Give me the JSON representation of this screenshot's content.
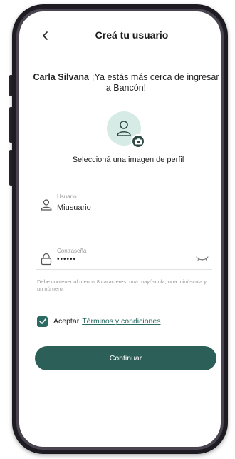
{
  "header": {
    "title": "Creá tu usuario"
  },
  "greeting": {
    "name": "Carla Silvana",
    "message": "¡Ya estás más cerca de ingresar a Bancón!"
  },
  "profile": {
    "label": "Seleccioná una imagen de perfil"
  },
  "username_field": {
    "label": "Usuario",
    "value": "Miusuario"
  },
  "password_field": {
    "label": "Contraseña",
    "value": "••••••"
  },
  "password_helper": "Debe contener al menos 8 caracteres, una mayúscula, una minúscula y un número.",
  "terms": {
    "checked": true,
    "prefix": "Aceptar",
    "link": "Términos y condiciones"
  },
  "continue_button": "Continuar",
  "colors": {
    "primary": "#2b5f57",
    "accent_link": "#2b6b63",
    "avatar_bg": "#d6ebe5"
  }
}
